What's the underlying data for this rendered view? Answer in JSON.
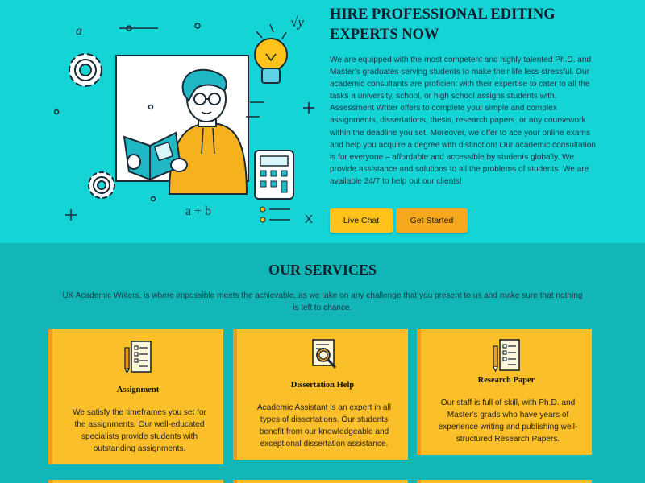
{
  "hero": {
    "title": "HIRE PROFESSIONAL EDITING EXPERTS NOW",
    "body": "We are equipped with the most competent and highly talented Ph.D. and Master's graduates serving students to make their life less stressful. Our academic consultants are proficient with their expertise to cater to all the tasks a university, school, or high school assigns students with. Assessment Writer offers to complete your simple and complex assignments, dissertations, thesis, research papers, or any coursework within the deadline you set. Moreover, we offer to ace your online exams and help you acquire a degree with distinction! Our academic consultation is for everyone – affordable and accessible by students globally. We provide assistance and solutions to all the problems of students. We are available 24/7 to help out our clients!",
    "live_chat_label": "Live Chat",
    "get_started_label": "Get Started",
    "illustration_text": {
      "a": "a",
      "sqrt": "√y",
      "apb": "a + b",
      "x": "X"
    }
  },
  "services": {
    "title": "OUR SERVICES",
    "subtitle": "UK Academic Writers, is where impossible meets the achievable, as we take on any challenge that you present to us and make sure that nothing is left to chance.",
    "cards": [
      {
        "title": "Assignment",
        "text": "We satisfy the timeframes you set for the assignments. Our well-educated specialists provide students with outstanding assignments.",
        "icon": "checklist-pencil-icon"
      },
      {
        "title": "Dissertation Help",
        "text": "Academic Assistant is an expert in all types of dissertations. Our students benefit from our knowledgeable and exceptional dissertation assistance.",
        "icon": "document-magnifier-icon"
      },
      {
        "title": "Research Paper",
        "text": "Our staff is full of skill, with Ph.D. and Master's grads who have years of experience writing and publishing well-structured Research Papers.",
        "icon": "checklist-pencil-icon"
      }
    ]
  },
  "colors": {
    "hero_bg": "#15d4d6",
    "services_bg": "#13b6b6",
    "card_bg": "#fbbf2a",
    "card_border": "#f19a1c",
    "button_live": "#ffc21a",
    "button_start": "#f6a81e"
  }
}
